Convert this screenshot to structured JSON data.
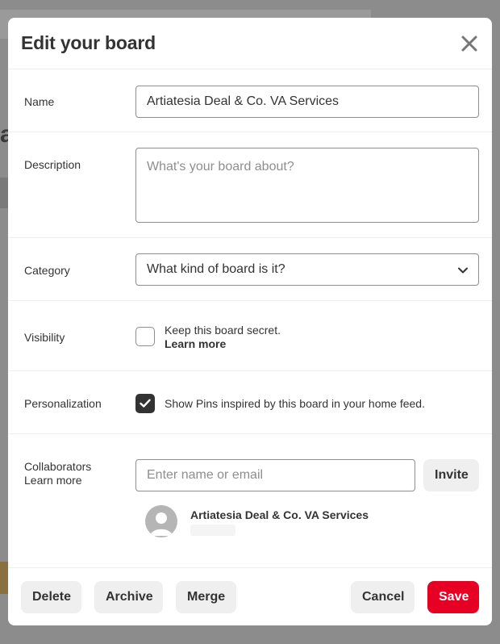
{
  "modal": {
    "title": "Edit your board"
  },
  "name_field": {
    "label": "Name",
    "value": "Artiatesia Deal & Co. VA Services"
  },
  "description_field": {
    "label": "Description",
    "placeholder": "What's your board about?"
  },
  "category_field": {
    "label": "Category",
    "selected": "What kind of board is it?"
  },
  "visibility": {
    "label": "Visibility",
    "checked": false,
    "text": "Keep this board secret.",
    "link": "Learn more"
  },
  "personalization": {
    "label": "Personalization",
    "checked": true,
    "text": "Show Pins inspired by this board in your home feed."
  },
  "collaborators": {
    "label": "Collaborators",
    "learn_more": "Learn more",
    "input_placeholder": "Enter name or email",
    "invite_label": "Invite",
    "list": [
      {
        "name": "Artiatesia Deal & Co. VA Services"
      }
    ]
  },
  "footer": {
    "delete_label": "Delete",
    "archive_label": "Archive",
    "merge_label": "Merge",
    "cancel_label": "Cancel",
    "save_label": "Save"
  },
  "colors": {
    "primary": "#e60023",
    "overlay": "#8c8c8c",
    "button_gray": "#efefef",
    "text": "#333333"
  }
}
